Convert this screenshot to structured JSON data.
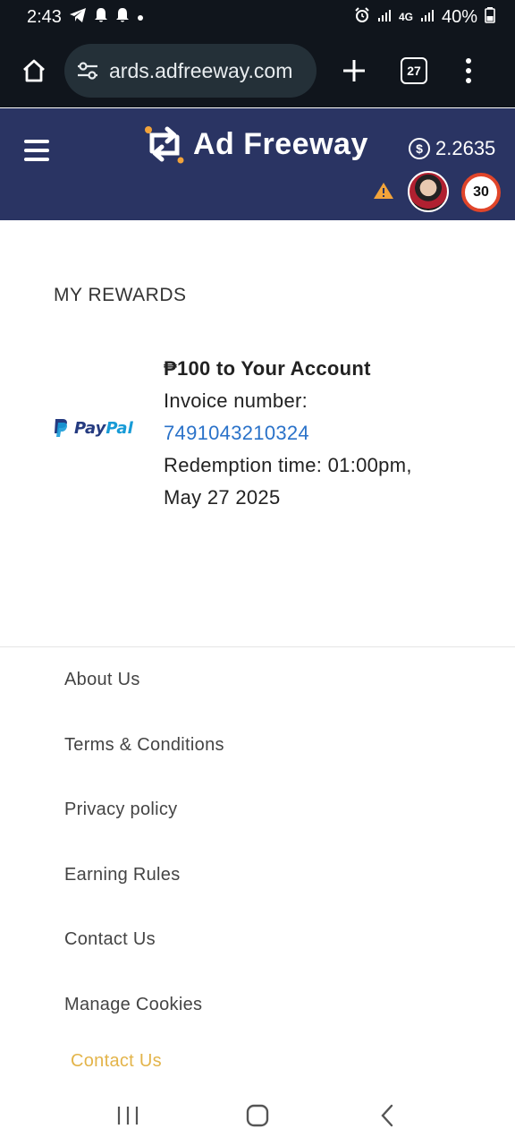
{
  "status_bar": {
    "time": "2:43",
    "signal_text": "4G",
    "battery": "40%"
  },
  "browser": {
    "url": "ards.adfreeway.com",
    "tab_count": "27"
  },
  "header": {
    "logo_text": "Ad Freeway",
    "balance": "2.2635",
    "level": "30"
  },
  "rewards": {
    "title": "MY REWARDS",
    "item": {
      "provider": "PayPal",
      "provider_pay": "Pay",
      "provider_pal": "Pal",
      "name": "₱100 to Your Account",
      "invoice_label": "Invoice number:",
      "invoice_number": "7491043210324",
      "redemption_line1": "Redemption time: 01:00pm,",
      "redemption_line2": "May 27 2025"
    }
  },
  "footer": {
    "links": [
      "About Us",
      "Terms & Conditions",
      "Privacy policy",
      "Earning Rules",
      "Contact Us",
      "Manage Cookies"
    ],
    "contact_highlight": "Contact Us"
  },
  "colors": {
    "header_bg": "#2a3463",
    "accent_orange": "#e0452a",
    "link_blue": "#2a72c9",
    "contact_gold": "#e3b44a"
  }
}
